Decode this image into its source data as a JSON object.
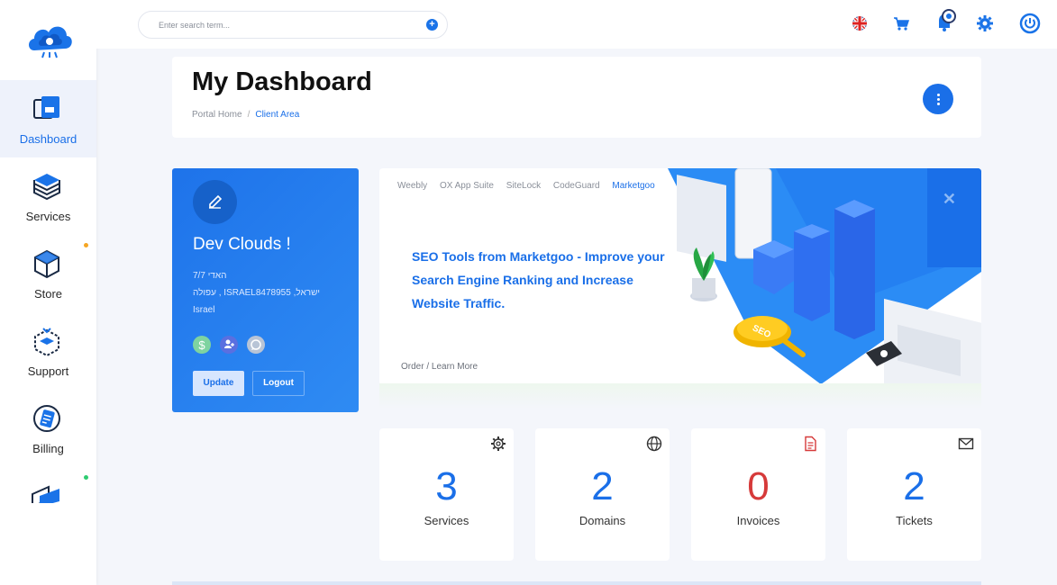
{
  "sidebar": {
    "logo_icon": "cloud-logo-icon",
    "items": [
      {
        "label": "Dashboard",
        "icon": "dashboard-icon",
        "active": true
      },
      {
        "label": "Services",
        "icon": "services-cube-icon"
      },
      {
        "label": "Store",
        "icon": "store-box-icon"
      },
      {
        "label": "Support",
        "icon": "support-box-icon"
      },
      {
        "label": "Billing",
        "icon": "billing-icon"
      },
      {
        "label": "",
        "icon": "domains-icon"
      }
    ],
    "dot_colors": [
      "#f5a623",
      "#2ecc71"
    ]
  },
  "topbar": {
    "search_placeholder": "Enter search term...",
    "icons": [
      "uk-flag-icon",
      "cart-icon",
      "bell-icon",
      "gear-icon",
      "power-icon"
    ]
  },
  "header": {
    "title": "My Dashboard",
    "breadcrumb": [
      "Portal Home",
      "Client Area"
    ]
  },
  "profile": {
    "name": "Dev Clouds !",
    "address_line1": "7/7 האדי",
    "address_line2": "עפולה , ISRAEL8478955 ,ישראל",
    "country": "Israel",
    "update_label": "Update",
    "logout_label": "Logout"
  },
  "promo": {
    "tabs": [
      "Weebly",
      "OX App Suite",
      "SiteLock",
      "CodeGuard",
      "Marketgoo"
    ],
    "active_tab": "Marketgoo",
    "headline": "SEO Tools from Marketgoo - Improve your Search Engine Ranking and Increase Website Traffic.",
    "link": "Order / Learn More",
    "badge_text": "SEO"
  },
  "stats": [
    {
      "value": "3",
      "label": "Services",
      "icon": "gear-icon"
    },
    {
      "value": "2",
      "label": "Domains",
      "icon": "globe-icon"
    },
    {
      "value": "0",
      "label": "Invoices",
      "icon": "document-icon"
    },
    {
      "value": "2",
      "label": "Tickets",
      "icon": "mail-icon"
    }
  ],
  "colors": {
    "accent": "#1a6fe8",
    "invoice_red": "#d63a3a",
    "background": "#f4f6fb"
  }
}
